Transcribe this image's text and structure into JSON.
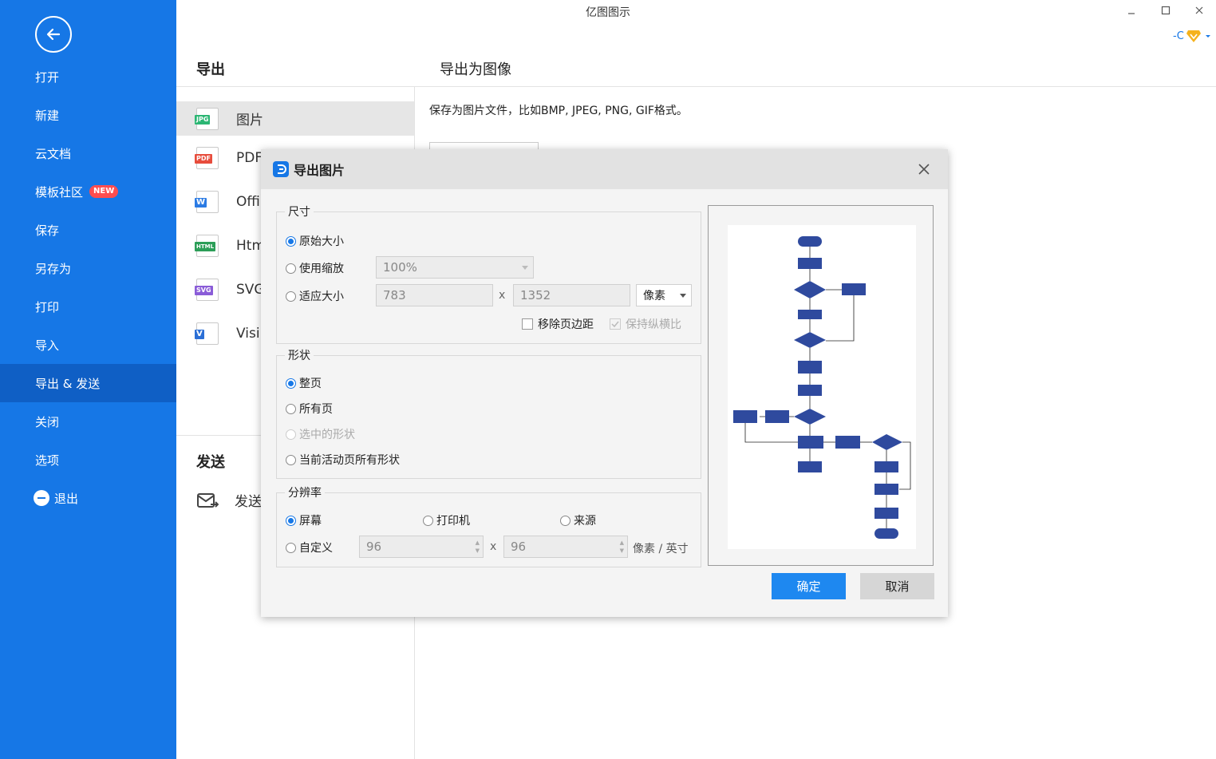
{
  "app": {
    "title": "亿图图示"
  },
  "user": {
    "label": "-C"
  },
  "sidebar": {
    "items": [
      {
        "label": "打开"
      },
      {
        "label": "新建"
      },
      {
        "label": "云文档"
      },
      {
        "label": "模板社区",
        "badge": "NEW"
      },
      {
        "label": "保存"
      },
      {
        "label": "另存为"
      },
      {
        "label": "打印"
      },
      {
        "label": "导入"
      },
      {
        "label": "导出 & 发送",
        "active": true
      },
      {
        "label": "关闭"
      },
      {
        "label": "选项"
      },
      {
        "label": "退出"
      }
    ]
  },
  "export_panel": {
    "header": "导出",
    "formats": [
      {
        "label": "图片",
        "tag": "JPG",
        "color": "#2bb673"
      },
      {
        "label": "PDF",
        "tag": "PDF",
        "color": "#e74c3c"
      },
      {
        "label": "Offi",
        "tag": "W",
        "color": "#2b7be4"
      },
      {
        "label": "Htm",
        "tag": "HTML",
        "color": "#2c9e58"
      },
      {
        "label": "SVG",
        "tag": "SVG",
        "color": "#8a5cd8"
      },
      {
        "label": "Visi",
        "tag": "V",
        "color": "#2b6fd6"
      }
    ],
    "send_header": "发送",
    "send_item": "发送"
  },
  "right": {
    "header": "导出为图像",
    "desc": "保存为图片文件，比如BMP, JPEG, PNG, GIF格式。"
  },
  "dialog": {
    "title": "导出图片",
    "size": {
      "legend": "尺寸",
      "original": "原始大小",
      "zoom": "使用缩放",
      "zoom_value": "100%",
      "fit": "适应大小",
      "width": "783",
      "height": "1352",
      "times": "x",
      "unit": "像素",
      "remove_margin": "移除页边距",
      "keep_ratio": "保持纵横比"
    },
    "shape": {
      "legend": "形状",
      "whole": "整页",
      "all": "所有页",
      "selected": "选中的形状",
      "current": "当前活动页所有形状"
    },
    "resolution": {
      "legend": "分辨率",
      "screen": "屏幕",
      "printer": "打印机",
      "source": "来源",
      "custom": "自定义",
      "dpi_x": "96",
      "dpi_y": "96",
      "times": "x",
      "unit": "像素 / 英寸"
    },
    "ok": "确定",
    "cancel": "取消",
    "colors": {
      "accent": "#1677e6",
      "flow_node": "#2f4a9e"
    }
  }
}
